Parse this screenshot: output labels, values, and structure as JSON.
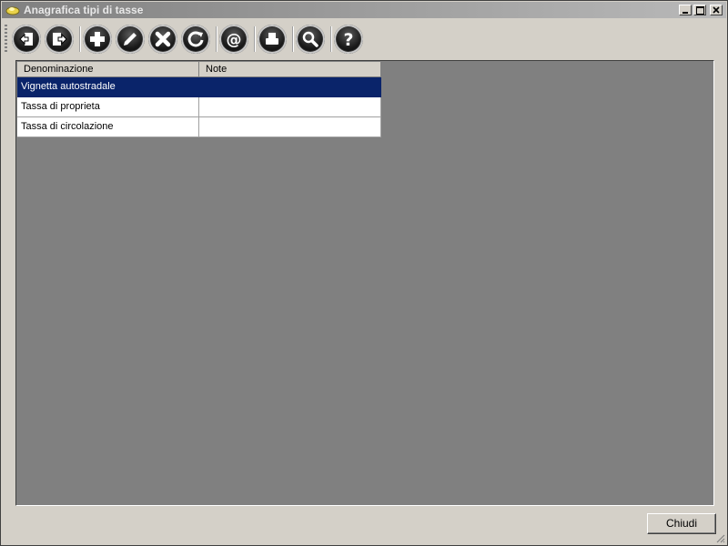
{
  "window": {
    "title": "Anagrafica tipi di tasse"
  },
  "toolbar": {
    "buttons": [
      {
        "name": "first-record",
        "icon": "arrow-left-door-icon"
      },
      {
        "name": "last-record",
        "icon": "arrow-right-door-icon"
      },
      {
        "name": "add",
        "icon": "plus-icon"
      },
      {
        "name": "edit",
        "icon": "pencil-icon"
      },
      {
        "name": "delete",
        "icon": "x-icon"
      },
      {
        "name": "refresh",
        "icon": "refresh-icon"
      },
      {
        "name": "email",
        "icon": "at-icon"
      },
      {
        "name": "print",
        "icon": "print-icon"
      },
      {
        "name": "search",
        "icon": "search-icon"
      },
      {
        "name": "help",
        "icon": "question-icon"
      }
    ]
  },
  "grid": {
    "columns": [
      "Denominazione",
      "Note"
    ],
    "rows": [
      {
        "denominazione": "Vignetta autostradale",
        "note": "",
        "selected": true
      },
      {
        "denominazione": "Tassa di proprieta",
        "note": "",
        "selected": false
      },
      {
        "denominazione": "Tassa di circolazione",
        "note": "",
        "selected": false
      }
    ]
  },
  "footer": {
    "close_label": "Chiudi"
  },
  "colors": {
    "selection": "#0a246a",
    "grid_background": "#808080",
    "window_background": "#d4d0c8"
  }
}
